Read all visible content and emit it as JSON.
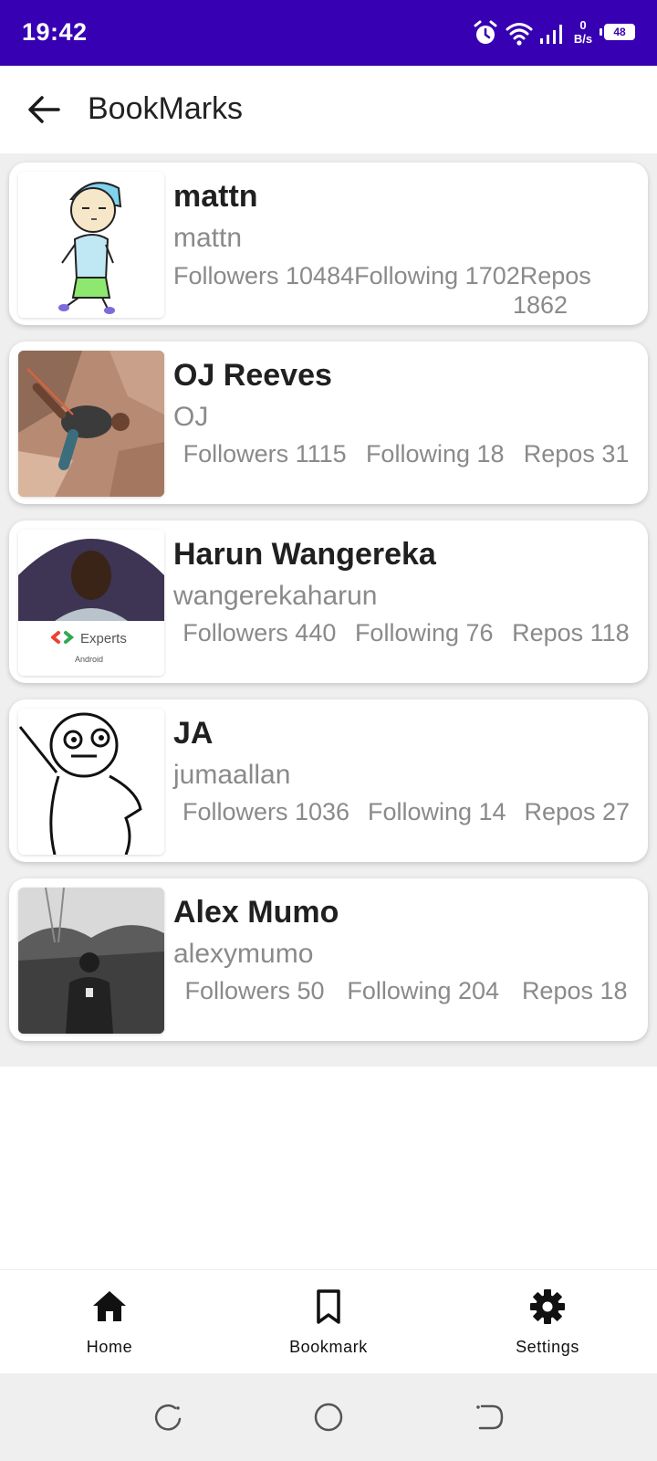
{
  "status_bar": {
    "time": "19:42",
    "net_speed_value": "0",
    "net_speed_unit": "B/s",
    "battery": "48",
    "icons": [
      "alarm-icon",
      "wifi-icon",
      "signal-icon",
      "battery-icon"
    ]
  },
  "app_bar": {
    "title": "BookMarks",
    "back_icon": "arrow-back-icon"
  },
  "bookmarks": [
    {
      "name": "mattn",
      "login": "mattn",
      "followers": "Followers 10484",
      "following": "Following 1702",
      "repos_label": "Repos",
      "repos_value": "1862"
    },
    {
      "name": "OJ Reeves",
      "login": "OJ",
      "followers": "Followers 1115",
      "following": "Following 18",
      "repos": "Repos 31"
    },
    {
      "name": "Harun Wangereka",
      "login": "wangerekaharun",
      "followers": "Followers 440",
      "following": "Following 76",
      "repos": "Repos 118",
      "avatar_caption": "Experts",
      "avatar_subcaption": "Android"
    },
    {
      "name": "JA",
      "login": "jumaallan",
      "followers": "Followers 1036",
      "following": "Following 14",
      "repos": "Repos 27"
    },
    {
      "name": "Alex Mumo",
      "login": "alexymumo",
      "followers": "Followers 50",
      "following": "Following 204",
      "repos": "Repos 18"
    }
  ],
  "bottom_nav": {
    "items": [
      {
        "label": "Home",
        "icon": "home-icon"
      },
      {
        "label": "Bookmark",
        "icon": "bookmark-icon"
      },
      {
        "label": "Settings",
        "icon": "settings-icon"
      }
    ]
  },
  "colors": {
    "status_bar": "#3700b3",
    "list_background": "#efefef",
    "card": "#ffffff",
    "secondary_text": "#8a8a8a"
  }
}
